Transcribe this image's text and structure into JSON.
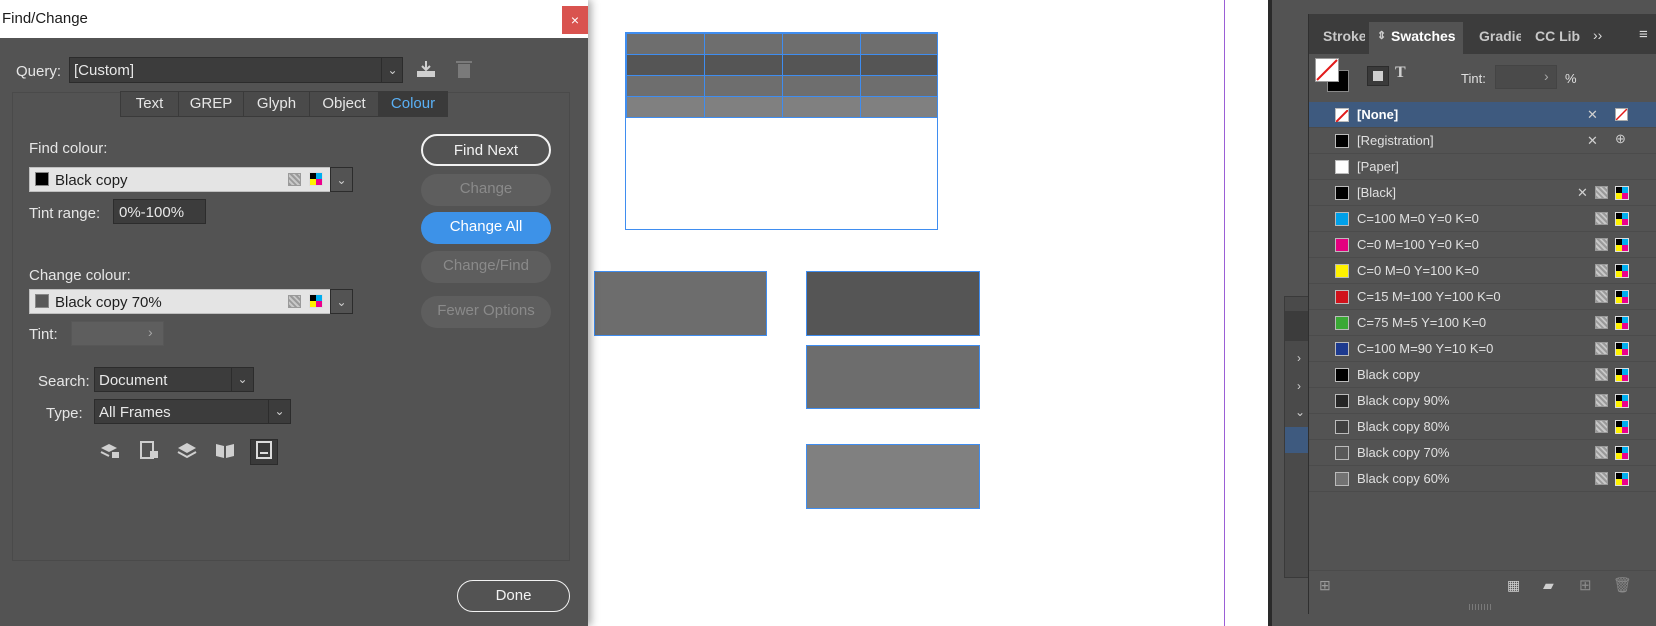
{
  "dialog": {
    "title": "Find/Change",
    "close_label": "×",
    "query_label": "Query:",
    "query_value": "[Custom]",
    "tabs": [
      {
        "label": "Text"
      },
      {
        "label": "GREP"
      },
      {
        "label": "Glyph"
      },
      {
        "label": "Object"
      },
      {
        "label": "Colour"
      }
    ],
    "find_colour_label": "Find colour:",
    "find_colour_value": "Black copy",
    "tint_range_label": "Tint range:",
    "tint_range_value": "0%-100%",
    "change_colour_label": "Change colour:",
    "change_colour_value": "Black copy 70%",
    "tint_label": "Tint:",
    "tint_value": "",
    "search_label": "Search:",
    "search_value": "Document",
    "type_label": "Type:",
    "type_value": "All Frames",
    "buttons": {
      "find_next": "Find Next",
      "change": "Change",
      "change_all": "Change All",
      "change_find": "Change/Find",
      "fewer_options": "Fewer Options",
      "done": "Done"
    },
    "colors": {
      "accent": "#3d92e8",
      "selected_tab": "#5ab0f5"
    }
  },
  "swatches_panel": {
    "tabs": [
      {
        "label": "Stroke"
      },
      {
        "label": "Swatches"
      },
      {
        "label": "Gradie"
      },
      {
        "label": "CC Libr"
      }
    ],
    "tint_label": "Tint:",
    "tint_value": "",
    "percent_sign": "%",
    "swatches": [
      {
        "name": "[None]",
        "color": "#ffffff"
      },
      {
        "name": "[Registration]",
        "color": "#000000"
      },
      {
        "name": "[Paper]",
        "color": "#ffffff"
      },
      {
        "name": "[Black]",
        "color": "#000000"
      },
      {
        "name": "C=100 M=0 Y=0 K=0",
        "color": "#00a0e9"
      },
      {
        "name": "C=0 M=100 Y=0 K=0",
        "color": "#e4007f"
      },
      {
        "name": "C=0 M=0 Y=100 K=0",
        "color": "#fff100"
      },
      {
        "name": "C=15 M=100 Y=100 K=0",
        "color": "#d0121b"
      },
      {
        "name": "C=75 M=5 Y=100 K=0",
        "color": "#3aa935"
      },
      {
        "name": "C=100 M=90 Y=10 K=0",
        "color": "#1d3a8f"
      },
      {
        "name": "Black copy",
        "color": "#000000"
      },
      {
        "name": "Black copy 90%",
        "color": "#262626"
      },
      {
        "name": "Black copy 80%",
        "color": "#404040"
      },
      {
        "name": "Black copy 70%",
        "color": "#595959"
      },
      {
        "name": "Black copy 60%",
        "color": "#737373"
      }
    ]
  },
  "icons": {
    "close": "close-icon",
    "dropdown": "chevron-down-icon",
    "save_query": "save-query-icon",
    "delete_query": "trash-icon"
  }
}
